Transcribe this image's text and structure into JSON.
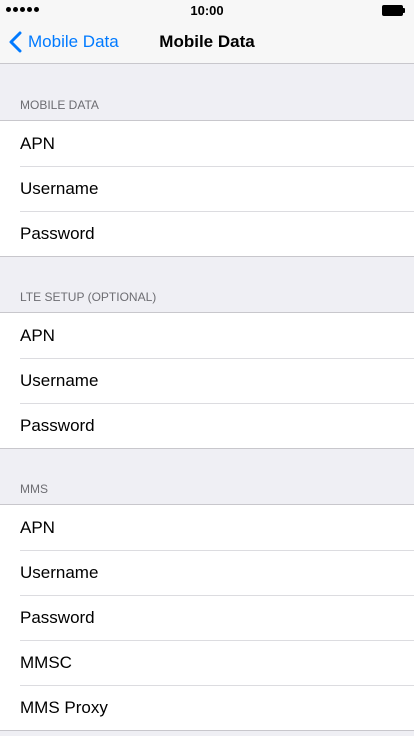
{
  "status_bar": {
    "time": "10:00",
    "signal_dots": 5
  },
  "nav": {
    "back_label": "Mobile Data",
    "title": "Mobile Data"
  },
  "sections": [
    {
      "header": "MOBILE DATA",
      "rows": [
        "APN",
        "Username",
        "Password"
      ]
    },
    {
      "header": "LTE SETUP (OPTIONAL)",
      "rows": [
        "APN",
        "Username",
        "Password"
      ]
    },
    {
      "header": "MMS",
      "rows": [
        "APN",
        "Username",
        "Password",
        "MMSC",
        "MMS Proxy"
      ]
    }
  ],
  "colors": {
    "accent": "#007aff",
    "background": "#efeff4",
    "header_text": "#6d6d72",
    "separator": "#c8c7cc"
  },
  "icons": {
    "back": "chevron-left-icon",
    "battery": "battery-icon",
    "signal": "signal-dots-icon"
  }
}
